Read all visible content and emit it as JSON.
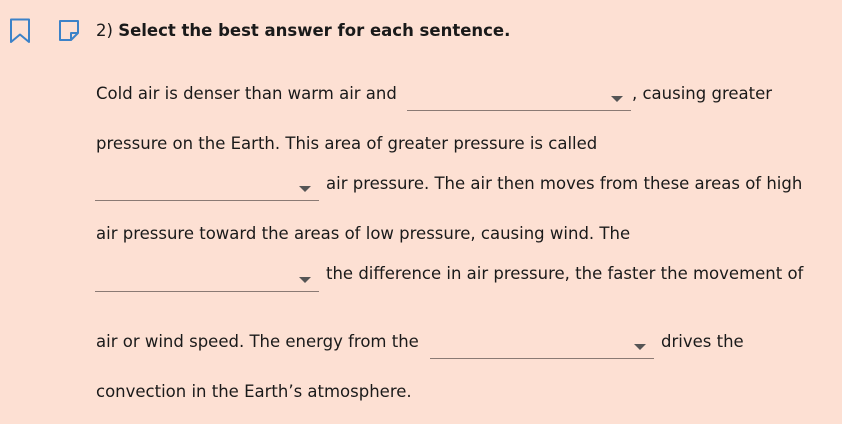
{
  "question": {
    "number": "2)",
    "prompt": "Select the best answer for each sentence."
  },
  "icons": {
    "bookmark": "bookmark-icon",
    "note": "note-icon"
  },
  "passage": {
    "line1_before": "Cold air is denser than warm air and",
    "line1_after": ", causing greater",
    "line2": "pressure on the Earth. This area of greater pressure is called",
    "line3_after": "air pressure. The air then moves from these areas of high",
    "line4": "air pressure toward the areas of low pressure, causing wind. The",
    "line5_after": "the difference in air pressure, the faster the movement of",
    "line6_before": "air or wind speed. The energy from the",
    "line6_after": "drives the",
    "line7": "convection in the Earth’s atmosphere."
  },
  "dropdowns": {
    "blank1": {
      "value": ""
    },
    "blank2": {
      "value": ""
    },
    "blank3": {
      "value": ""
    },
    "blank4": {
      "value": ""
    }
  },
  "colors": {
    "background": "#fde0d3",
    "icon_blue": "#3c82c8"
  }
}
